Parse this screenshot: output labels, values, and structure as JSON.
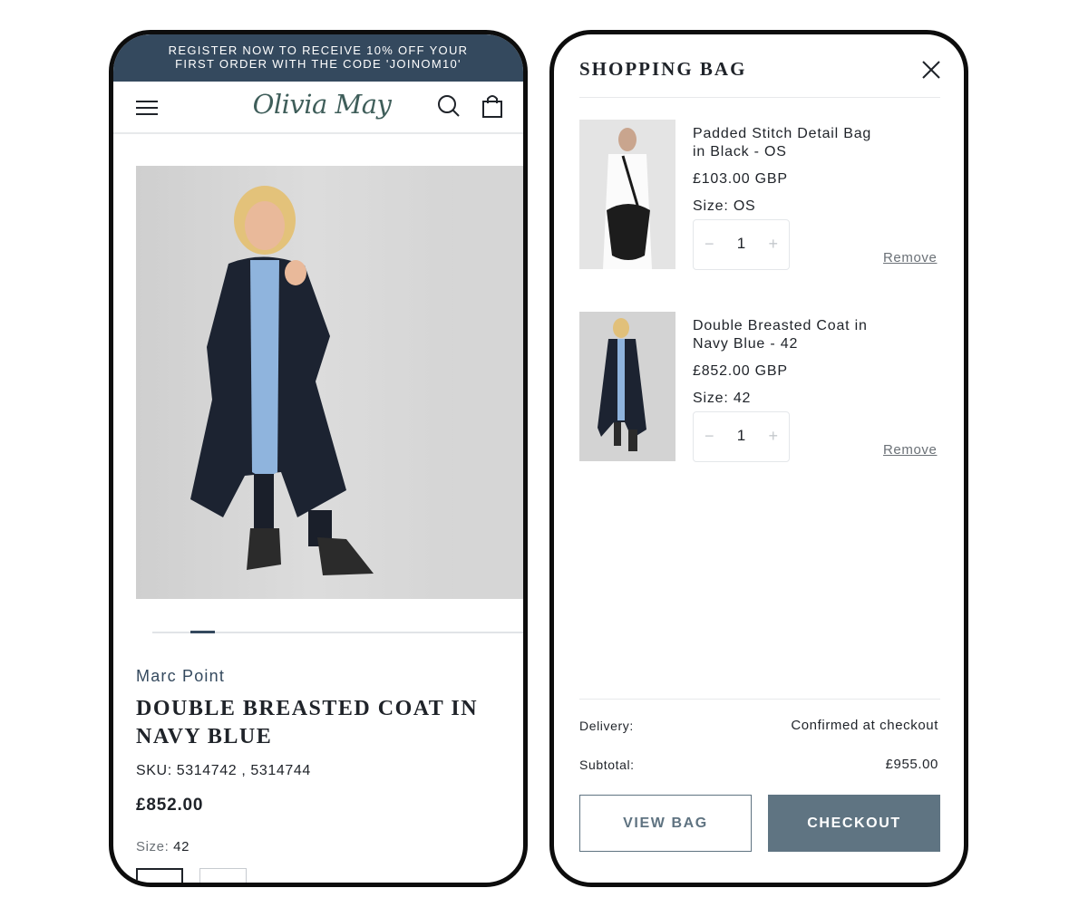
{
  "promo_banner": {
    "line1": "REGISTER NOW TO RECEIVE 10% OFF YOUR",
    "line2": "FIRST ORDER WITH THE CODE 'JOINOM10'"
  },
  "header": {
    "logo_text": "Olivia May"
  },
  "product": {
    "brand": "Marc Point",
    "title_line1": "DOUBLE BREASTED COAT IN",
    "title_line2": "NAVY BLUE",
    "sku": "SKU: 5314742 , 5314744",
    "price": "£852.00",
    "size_label": "Size:",
    "size_value": "42"
  },
  "cart": {
    "title": "SHOPPING BAG",
    "items": [
      {
        "name_line1": "Padded Stitch Detail Bag",
        "name_line2": "in Black - OS",
        "price": "£103.00 GBP",
        "size": "Size: OS",
        "quantity": "1",
        "remove_label": "Remove"
      },
      {
        "name_line1": "Double Breasted Coat in",
        "name_line2": "Navy Blue - 42",
        "price": "£852.00 GBP",
        "size": "Size: 42",
        "quantity": "1",
        "remove_label": "Remove"
      }
    ],
    "delivery_label": "Delivery:",
    "delivery_value": "Confirmed at checkout",
    "subtotal_label": "Subtotal:",
    "subtotal_value": "£955.00",
    "view_bag_label": "VIEW BAG",
    "checkout_label": "CHECKOUT"
  },
  "colors": {
    "banner": "#34495e",
    "accent": "#5f7482",
    "text": "#1f2329"
  },
  "icons": [
    "menu-icon",
    "search-icon",
    "bag-icon",
    "close-icon",
    "minus-icon",
    "plus-icon"
  ]
}
